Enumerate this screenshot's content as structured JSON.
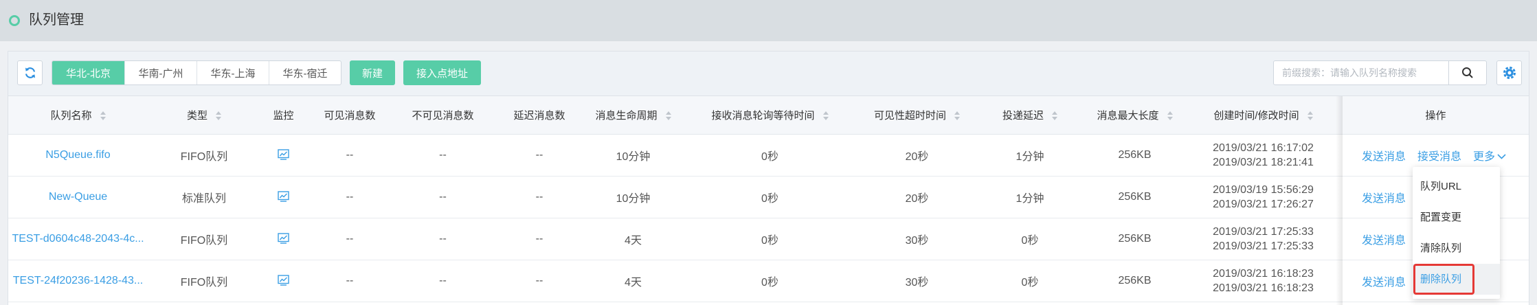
{
  "page": {
    "title": "队列管理"
  },
  "colors": {
    "accent": "#57cda7",
    "link": "#3a9ee4",
    "highlight_box": "#e53935"
  },
  "toolbar": {
    "refresh_icon": "refresh-icon",
    "regions": [
      {
        "label": "华北-北京",
        "active": true
      },
      {
        "label": "华南-广州",
        "active": false
      },
      {
        "label": "华东-上海",
        "active": false
      },
      {
        "label": "华东-宿迁",
        "active": false
      }
    ],
    "create_label": "新建",
    "endpoint_label": "接入点地址",
    "search_placeholder": "前缀搜索：请输入队列名称搜索",
    "search_value": "",
    "search_icon": "search-icon",
    "settings_icon": "gear-icon"
  },
  "table": {
    "columns": [
      {
        "label": "队列名称",
        "sortable": true
      },
      {
        "label": "类型",
        "sortable": true
      },
      {
        "label": "监控",
        "sortable": false
      },
      {
        "label": "可见消息数",
        "sortable": false
      },
      {
        "label": "不可见消息数",
        "sortable": false
      },
      {
        "label": "延迟消息数",
        "sortable": false
      },
      {
        "label": "消息生命周期",
        "sortable": true
      },
      {
        "label": "接收消息轮询等待时间",
        "sortable": true
      },
      {
        "label": "可见性超时时间",
        "sortable": true
      },
      {
        "label": "投递延迟",
        "sortable": true
      },
      {
        "label": "消息最大长度",
        "sortable": true
      },
      {
        "label": "创建时间/修改时间",
        "sortable": true
      },
      {
        "label": "操作",
        "sortable": false
      }
    ],
    "rows": [
      {
        "name": "N5Queue.fifo",
        "type": "FIFO队列",
        "visible": "--",
        "invisible": "--",
        "delayed": "--",
        "lifecycle": "10分钟",
        "poll_wait": "0秒",
        "visibility_timeout": "20秒",
        "delivery_delay": "1分钟",
        "max_size": "256KB",
        "created": "2019/03/21 16:17:02",
        "modified": "2019/03/21 18:21:41",
        "actions": [
          "发送消息",
          "接受消息"
        ],
        "more": "更多"
      },
      {
        "name": "New-Queue",
        "type": "标准队列",
        "visible": "--",
        "invisible": "--",
        "delayed": "--",
        "lifecycle": "10分钟",
        "poll_wait": "0秒",
        "visibility_timeout": "20秒",
        "delivery_delay": "1分钟",
        "max_size": "256KB",
        "created": "2019/03/19 15:56:29",
        "modified": "2019/03/21 17:26:27",
        "actions": [
          "发送消息"
        ]
      },
      {
        "name": "TEST-d0604c48-2043-4c...",
        "type": "FIFO队列",
        "visible": "--",
        "invisible": "--",
        "delayed": "--",
        "lifecycle": "4天",
        "poll_wait": "0秒",
        "visibility_timeout": "30秒",
        "delivery_delay": "0秒",
        "max_size": "256KB",
        "created": "2019/03/21 17:25:33",
        "modified": "2019/03/21 17:25:33",
        "actions": [
          "发送消息"
        ]
      },
      {
        "name": "TEST-24f20236-1428-43...",
        "type": "FIFO队列",
        "visible": "--",
        "invisible": "--",
        "delayed": "--",
        "lifecycle": "4天",
        "poll_wait": "0秒",
        "visibility_timeout": "30秒",
        "delivery_delay": "0秒",
        "max_size": "256KB",
        "created": "2019/03/21 16:18:23",
        "modified": "2019/03/21 16:18:23",
        "actions": [
          "发送消息"
        ]
      }
    ]
  },
  "more_menu": {
    "items": [
      {
        "label": "队列URL",
        "highlighted": false
      },
      {
        "label": "配置变更",
        "highlighted": false
      },
      {
        "label": "清除队列",
        "highlighted": false
      },
      {
        "label": "删除队列",
        "highlighted": true
      }
    ]
  }
}
